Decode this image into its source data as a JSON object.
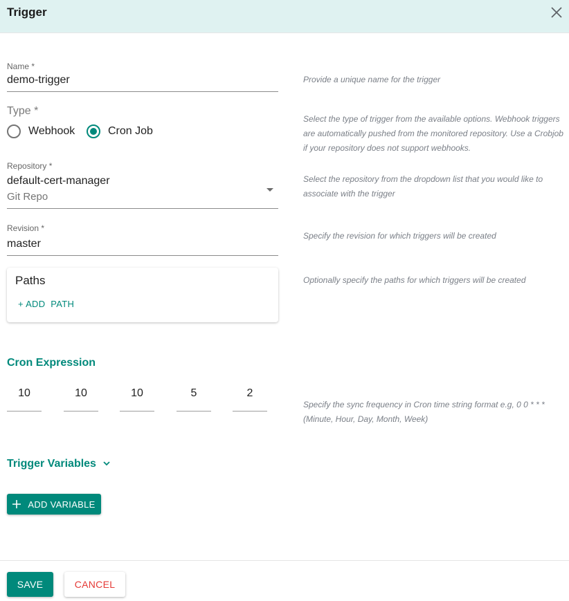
{
  "dialog": {
    "title": "Trigger",
    "close_icon": "close-icon"
  },
  "form": {
    "name": {
      "label": "Name *",
      "value": "demo-trigger",
      "hint": "Provide a unique name for the trigger"
    },
    "type": {
      "label": "Type *",
      "options": [
        {
          "label": "Webhook",
          "checked": false
        },
        {
          "label": "Cron Job",
          "checked": true
        }
      ],
      "hint": "Select the type of trigger from the available options. Webhook triggers are automatically pushed from the monitored repository. Use a Crobjob if your repository does not support webhooks."
    },
    "repository": {
      "label": "Repository *",
      "value": "default-cert-manager",
      "subtext": "Git Repo",
      "icon": "caret-down-icon",
      "hint": "Select the repository from the dropdown list that you would like to associate with the trigger"
    },
    "revision": {
      "label": "Revision *",
      "value": "master",
      "hint": "Specify the revision for which triggers will be created"
    },
    "paths": {
      "title": "Paths",
      "add_label": "+ ADD  PATH",
      "hint": "Optionally specify the paths for which triggers will be created"
    },
    "cron": {
      "title": "Cron Expression",
      "fields": [
        "10",
        "10",
        "10",
        "5",
        "2"
      ],
      "hint": "Specify the sync frequency in Cron time string format e.g, 0 0 * * * (Minute, Hour, Day, Month, Week)"
    },
    "variables": {
      "title": "Trigger Variables",
      "add_label": "ADD VARIABLE"
    }
  },
  "footer": {
    "save_label": "SAVE",
    "cancel_label": "CANCEL"
  },
  "colors": {
    "accent": "#00897b",
    "header_bg": "#dff2f1",
    "cancel": "#e53935"
  }
}
